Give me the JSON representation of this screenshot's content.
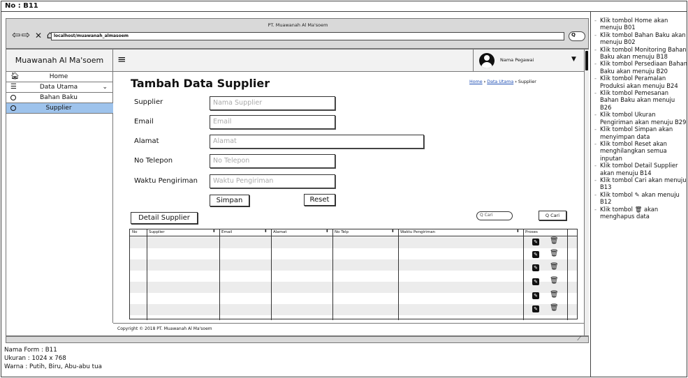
{
  "header": {
    "no_label": "No : B11"
  },
  "browser": {
    "title": "PT. Muawanah Al Ma'soem",
    "url": "localhost/muawanah_almasoem",
    "nav": {
      "back": "⇦",
      "forward": "⇨",
      "close": "✕",
      "home": "⌂"
    },
    "search_btn": "Q"
  },
  "app": {
    "brand": "Muawanah Al Ma'soem",
    "menu_icon": "≡",
    "user_name": "Nama Pegawai",
    "user_caret": "▼",
    "sidebar": [
      {
        "label": "Home",
        "icon": "home-icon",
        "glyph": "🏠︎"
      },
      {
        "label": "Data Utama",
        "icon": "database-icon",
        "glyph": "☰",
        "chevron": "⌄"
      },
      {
        "label": "Bahan Baku",
        "icon": "circle-icon"
      },
      {
        "label": "Supplier",
        "icon": "circle-icon",
        "active": true
      }
    ],
    "page_title": "Tambah Data Supplier",
    "breadcrumb": {
      "home": "Home",
      "sep": "›",
      "data_utama": "Data Utama",
      "current": "Supplier"
    },
    "form": {
      "fields": [
        {
          "label": "Supplier",
          "placeholder": "Nama Supplier"
        },
        {
          "label": "Email",
          "placeholder": "Email"
        },
        {
          "label": "Alamat",
          "placeholder": "Alamat"
        },
        {
          "label": "No Telepon",
          "placeholder": "No Telepon"
        },
        {
          "label": "Waktu Pengiriman",
          "placeholder": "Waktu Pengiriman"
        }
      ],
      "simpan": "Simpan",
      "reset": "Reset"
    },
    "detail_button": "Detail Supplier",
    "search": {
      "placeholder": "Q Cari",
      "button": "Q Cari"
    },
    "table": {
      "headers": [
        "No",
        "Supplier",
        "Email",
        "Alamat",
        "No Telp",
        "Waktu Pengiriman",
        "Proses"
      ],
      "sort_glyph": "⬍",
      "edit_glyph": "✎",
      "delete_glyph": "🗑︎"
    },
    "copyright": "Copyright © 2018 PT. Muawanah Al Ma'soem"
  },
  "meta": {
    "form_name": "Nama Form : B11",
    "size": "Ukuran : 1024 x 768",
    "color": "Warna : Putih, Biru, Abu-abu tua"
  },
  "notes": [
    "Klik tombol Home akan menuju B01",
    "Klik tombol Bahan Baku akan menuju B02",
    "Klik tombol Monitoring Bahan Baku akan menuju B18",
    "Klik tombol Persediaan Bahan Baku akan menuju B20",
    "Klik tombol Peramalan Produksi akan menuju B24",
    "Klik tombol Pemesanan Bahan Baku akan menuju B26",
    "Klik tombol Ukuran Pengiriman akan menuju B29",
    "Klik tombol Simpan akan menyimpan data",
    "Klik tombol Reset akan menghilangkan semua inputan",
    "Klik tombol Detail Supplier akan menuju B14",
    "Klik tombol Cari akan menuju B13",
    "Klik tombol ✎ akan menuju B12",
    "Klik tombol 🗑︎ akan menghapus data"
  ],
  "colors": {
    "active_menu": "#9ec3ec",
    "chrome": "#d9d9d9",
    "link": "#1f4fb5"
  }
}
